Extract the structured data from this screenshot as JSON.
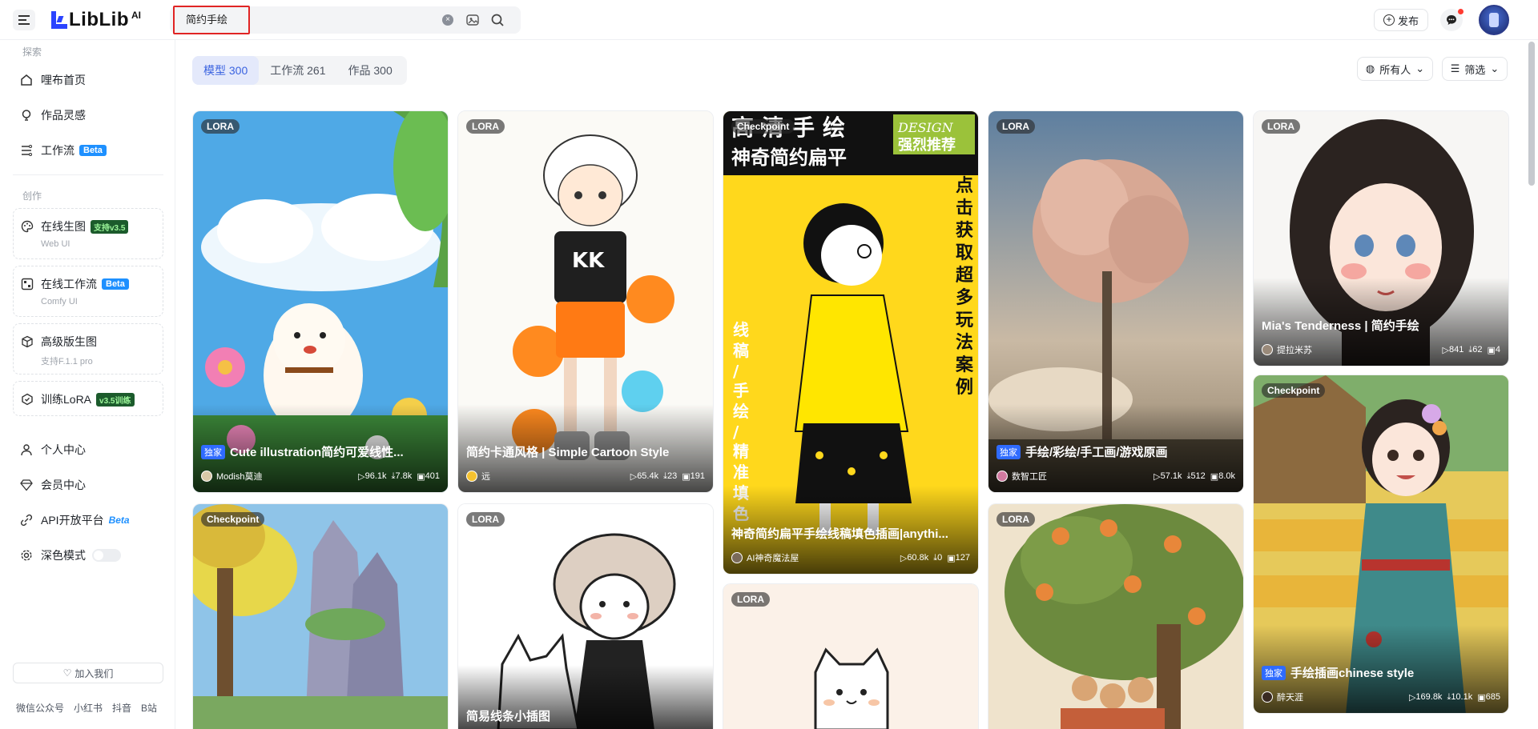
{
  "app": {
    "logo_text": "LibLib",
    "logo_ai": "AI"
  },
  "search": {
    "value": "简约手绘",
    "placeholder": ""
  },
  "header": {
    "publish_label": "发布"
  },
  "sidebar": {
    "explore_title": "探索",
    "explore_items": [
      {
        "label": "哩布首页",
        "icon": "home-icon"
      },
      {
        "label": "作品灵感",
        "icon": "bulb-icon"
      },
      {
        "label": "工作流",
        "icon": "workflow-icon",
        "badge": "Beta"
      }
    ],
    "create_title": "创作",
    "create_items": [
      {
        "label": "在线生图",
        "sub": "Web UI",
        "badge": "支持v3.5",
        "icon": "palette-icon"
      },
      {
        "label": "在线工作流",
        "sub": "Comfy UI",
        "badge": "Beta",
        "icon": "flow-icon"
      },
      {
        "label": "高级版生图",
        "sub": "支持F.1.1 pro",
        "badge": "",
        "icon": "cube-icon"
      },
      {
        "label": "训练LoRA",
        "sub": "",
        "badge": "v3.5训练",
        "icon": "hex-icon"
      }
    ],
    "bottom_items": [
      {
        "label": "个人中心",
        "icon": "user-icon"
      },
      {
        "label": "会员中心",
        "icon": "diamond-icon"
      },
      {
        "label": "API开放平台",
        "icon": "api-icon",
        "badge": "Beta"
      }
    ],
    "dark_mode_label": "深色模式",
    "join_label": "加入我们",
    "footer_links": [
      "微信公众号",
      "小红书",
      "抖音",
      "B站"
    ]
  },
  "tabs": [
    {
      "label": "模型 300",
      "active": true
    },
    {
      "label": "工作流 261",
      "active": false
    },
    {
      "label": "作品 300",
      "active": false
    }
  ],
  "filters": {
    "owner_label": "所有人",
    "filter_label": "筛选"
  },
  "cards": [
    {
      "type": "LORA",
      "exclusive": true,
      "title": "Cute illustration简约可爱线性...",
      "author": "Modish莫迪",
      "runs": "96.1k",
      "downloads": "7.8k",
      "images": "401"
    },
    {
      "type": "LORA",
      "exclusive": false,
      "title": "简约卡通风格 | Simple Cartoon Style",
      "author": "远",
      "runs": "65.4k",
      "downloads": "23",
      "images": "191"
    },
    {
      "type": "Checkpoint",
      "exclusive": false,
      "title": "神奇简约扁平手绘线稿填色插画|anythi...",
      "author": "AI神奇魔法屋",
      "runs": "60.8k",
      "downloads": "0",
      "images": "127",
      "poster_lines": [
        "高清手绘",
        "神奇简约扁平",
        "点击获取超多玩法案例",
        "线稿/手绘/精准填色",
        "DESIGN",
        "强烈推荐"
      ]
    },
    {
      "type": "LORA",
      "exclusive": true,
      "title": "手绘/彩绘/手工画/游戏原画",
      "author": "数智工匠",
      "runs": "57.1k",
      "downloads": "512",
      "images": "8.0k"
    },
    {
      "type": "LORA",
      "exclusive": false,
      "title": "Mia's Tenderness | 简约手绘",
      "author": "提拉米苏",
      "runs": "841",
      "downloads": "62",
      "images": "4"
    },
    {
      "type": "Checkpoint",
      "exclusive": true,
      "title": "手绘插画chinese style",
      "author": "醉天涯",
      "runs": "169.8k",
      "downloads": "10.1k",
      "images": "685"
    },
    {
      "type": "Checkpoint",
      "exclusive": false,
      "title": "",
      "author": "",
      "runs": "",
      "downloads": "",
      "images": ""
    },
    {
      "type": "LORA",
      "exclusive": false,
      "title": "简易线条小插图",
      "author": "",
      "runs": "",
      "downloads": "",
      "images": ""
    },
    {
      "type": "LORA",
      "exclusive": false,
      "title": "",
      "author": "",
      "runs": "",
      "downloads": "",
      "images": ""
    },
    {
      "type": "LORA",
      "exclusive": false,
      "title": "",
      "author": "",
      "runs": "",
      "downloads": "",
      "images": ""
    }
  ],
  "colors": {
    "accent": "#3a63e0",
    "beta_blue": "#1e90ff",
    "highlight_red": "#e02424"
  }
}
